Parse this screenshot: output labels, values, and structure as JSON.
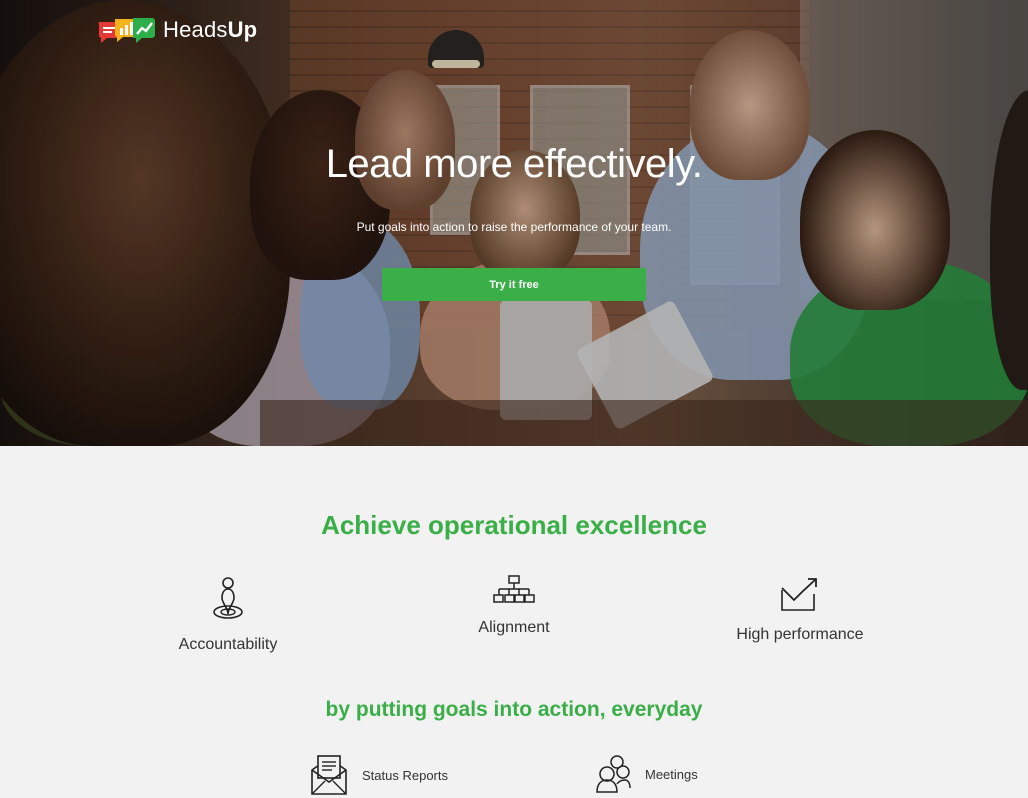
{
  "brand": {
    "name_light": "Heads",
    "name_bold": "Up"
  },
  "hero": {
    "title": "Lead more effectively.",
    "subtitle": "Put goals into action to raise the performance of your team.",
    "cta_label": "Try it free"
  },
  "section1": {
    "title": "Achieve operational excellence",
    "features": [
      {
        "label": "Accountability",
        "icon": "person-target-icon"
      },
      {
        "label": "Alignment",
        "icon": "org-chart-icon"
      },
      {
        "label": "High performance",
        "icon": "growth-chart-icon"
      }
    ]
  },
  "section2": {
    "title": "by putting goals into action, everyday",
    "items": [
      {
        "label": "Status Reports",
        "icon": "envelope-report-icon"
      },
      {
        "label": "Meetings",
        "icon": "meeting-people-icon"
      }
    ]
  },
  "colors": {
    "accent": "#3aaf48",
    "background": "#f1f2f1"
  }
}
